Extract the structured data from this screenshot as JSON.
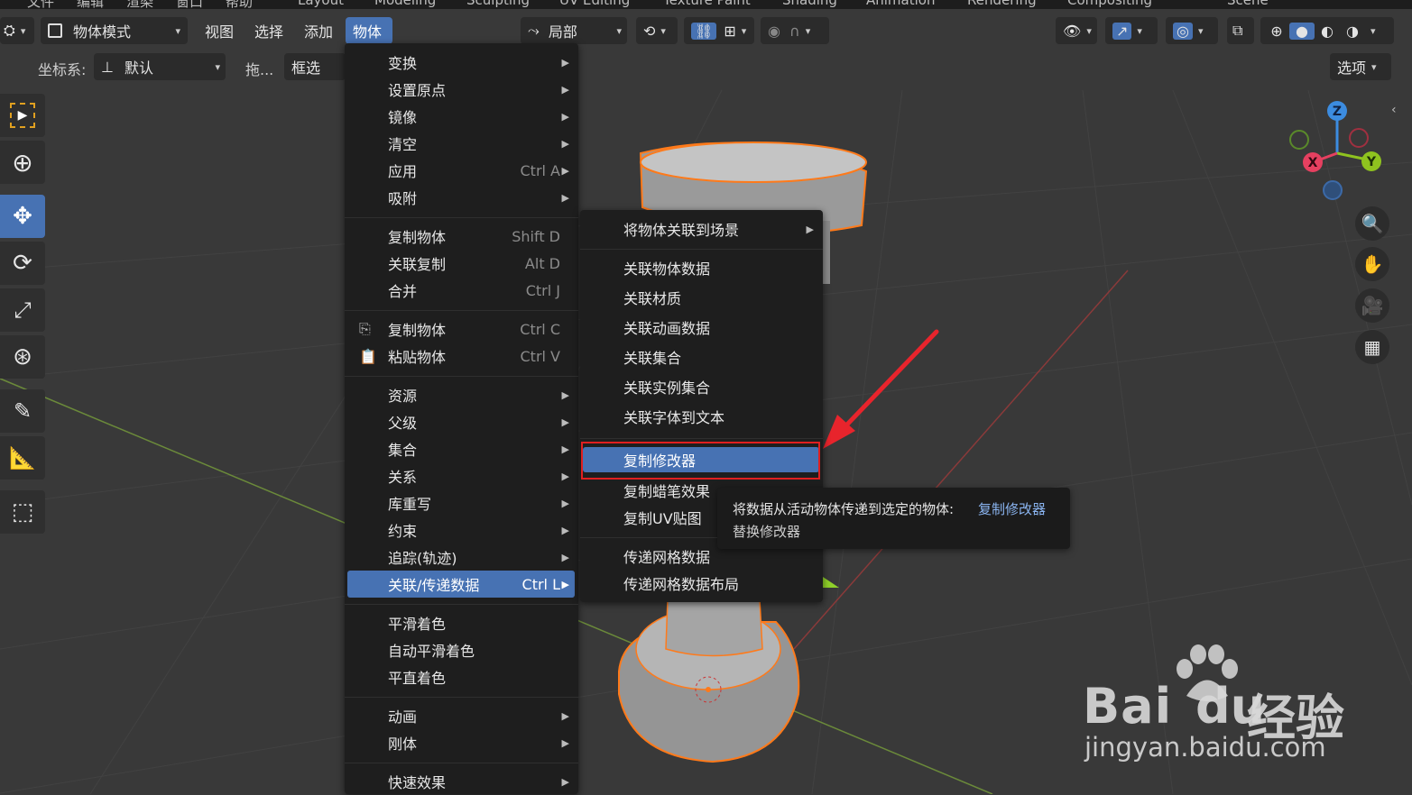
{
  "top_strip": {
    "items": [
      "文件",
      "编辑",
      "渲染",
      "窗口",
      "帮助",
      "Layout",
      "Modeling",
      "Sculpting",
      "UV Editing",
      "Texture Paint",
      "Shading",
      "Animation",
      "Rendering",
      "Compositing",
      "Scene"
    ]
  },
  "header": {
    "mode_label": "物体模式",
    "menus": {
      "view": "视图",
      "select": "选择",
      "add": "添加",
      "object": "物体"
    },
    "transform_orientation": "局部",
    "options_label": "选项"
  },
  "header2": {
    "coord_label": "坐标系:",
    "coord_value": "默认",
    "drag_label": "拖...",
    "drag_value": "框选"
  },
  "object_menu": {
    "items": [
      {
        "label": "变换",
        "shortcut": "",
        "submenu": true
      },
      {
        "label": "设置原点",
        "shortcut": "",
        "submenu": true
      },
      {
        "label": "镜像",
        "shortcut": "",
        "submenu": true
      },
      {
        "label": "清空",
        "shortcut": "",
        "submenu": true
      },
      {
        "label": "应用",
        "shortcut": "Ctrl A",
        "submenu": true
      },
      {
        "label": "吸附",
        "shortcut": "",
        "submenu": true
      },
      {
        "label": "复制物体",
        "shortcut": "Shift D",
        "submenu": false
      },
      {
        "label": "关联复制",
        "shortcut": "Alt D",
        "submenu": false
      },
      {
        "label": "合并",
        "shortcut": "Ctrl J",
        "submenu": false
      },
      {
        "label": "复制物体",
        "shortcut": "Ctrl C",
        "submenu": false
      },
      {
        "label": "粘贴物体",
        "shortcut": "Ctrl V",
        "submenu": false
      },
      {
        "label": "资源",
        "shortcut": "",
        "submenu": true
      },
      {
        "label": "父级",
        "shortcut": "",
        "submenu": true
      },
      {
        "label": "集合",
        "shortcut": "",
        "submenu": true
      },
      {
        "label": "关系",
        "shortcut": "",
        "submenu": true
      },
      {
        "label": "库重写",
        "shortcut": "",
        "submenu": true
      },
      {
        "label": "约束",
        "shortcut": "",
        "submenu": true
      },
      {
        "label": "追踪(轨迹)",
        "shortcut": "",
        "submenu": true
      },
      {
        "label": "关联/传递数据",
        "shortcut": "Ctrl L",
        "submenu": true
      },
      {
        "label": "平滑着色",
        "shortcut": "",
        "submenu": false
      },
      {
        "label": "自动平滑着色",
        "shortcut": "",
        "submenu": false
      },
      {
        "label": "平直着色",
        "shortcut": "",
        "submenu": false
      },
      {
        "label": "动画",
        "shortcut": "",
        "submenu": true
      },
      {
        "label": "刚体",
        "shortcut": "",
        "submenu": true
      },
      {
        "label": "快速效果",
        "shortcut": "",
        "submenu": true
      }
    ]
  },
  "link_menu": {
    "items": [
      {
        "label": "将物体关联到场景",
        "submenu": true
      },
      {
        "label": "关联物体数据",
        "submenu": false
      },
      {
        "label": "关联材质",
        "submenu": false
      },
      {
        "label": "关联动画数据",
        "submenu": false
      },
      {
        "label": "关联集合",
        "submenu": false
      },
      {
        "label": "关联实例集合",
        "submenu": false
      },
      {
        "label": "关联字体到文本",
        "submenu": false
      },
      {
        "label": "复制修改器",
        "submenu": false
      },
      {
        "label": "复制蜡笔效果",
        "submenu": false
      },
      {
        "label": "复制UV贴图",
        "submenu": false
      },
      {
        "label": "传递网格数据",
        "submenu": false
      },
      {
        "label": "传递网格数据布局",
        "submenu": false
      }
    ]
  },
  "tooltip": {
    "description": "将数据从活动物体传递到选定的物体:",
    "operator": "复制修改器",
    "python": "替换修改器"
  },
  "gizmo": {
    "x": "X",
    "y": "Y",
    "z": "Z"
  },
  "watermark": {
    "brand": "Bai",
    "brand_suffix": "du",
    "cn": "经验",
    "url": "jingyan.baidu.com"
  },
  "colors": {
    "accent": "#4772b3",
    "menu_bg": "#1e1e1e",
    "highlight_box": "#e02020",
    "arrow": "#e8242c",
    "selection": "#ff7a1a"
  }
}
